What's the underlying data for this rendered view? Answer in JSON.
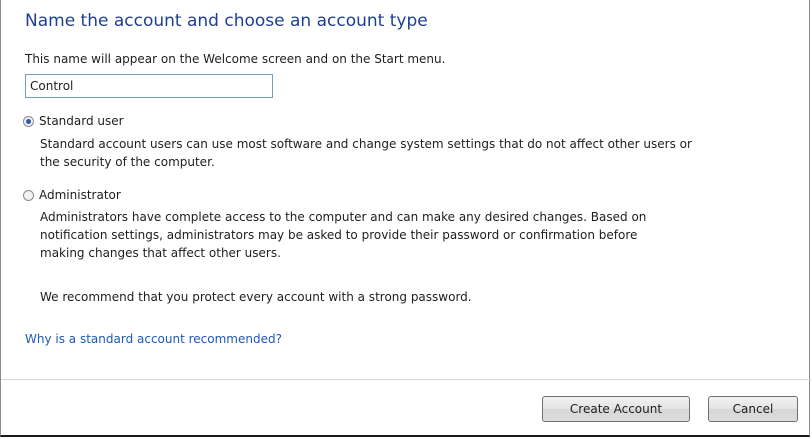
{
  "dialog": {
    "title": "Name the account and choose an account type",
    "name_description": "This name will appear on the Welcome screen and on the Start menu.",
    "name_value": "Control",
    "account_types": [
      {
        "label": "Standard user",
        "checked": true,
        "description_lines": [
          "Standard account users can use most software and change system settings that do not affect other users or",
          "the security of the computer."
        ]
      },
      {
        "label": "Administrator",
        "checked": false,
        "description_lines": [
          "Administrators have complete access to the computer and can make any desired changes. Based on",
          "notification settings, administrators may be asked to provide their password or confirmation before",
          "making changes that affect other users."
        ]
      }
    ],
    "recommendation": "We recommend that you protect every account with a strong password.",
    "help_link": "Why is a standard account recommended?",
    "buttons": {
      "create": "Create Account",
      "cancel": "Cancel"
    },
    "colors": {
      "title": "#1e3f91",
      "link": "#1f58b6"
    }
  }
}
